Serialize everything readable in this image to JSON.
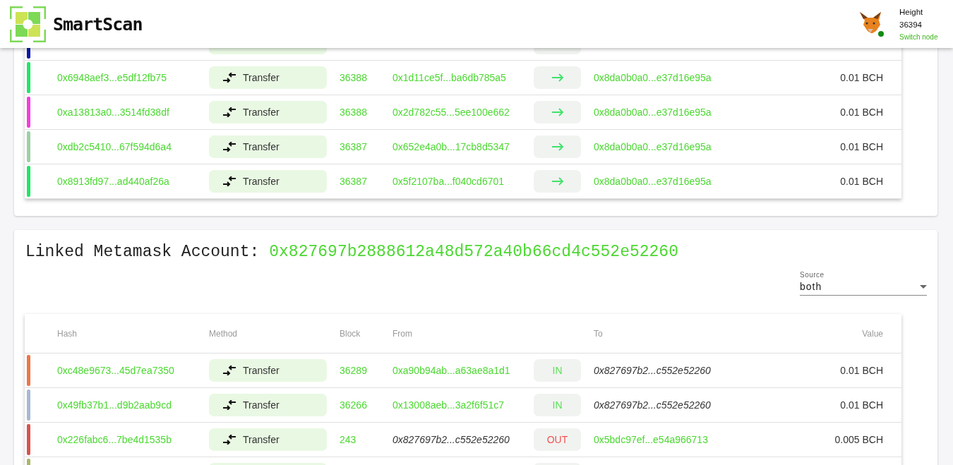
{
  "header": {
    "brand": "SmartScan",
    "height_label": "Height",
    "height_value": "36394",
    "switch_link": "Switch node",
    "node_online": true
  },
  "recent": {
    "rows": [
      {
        "kind": "partial",
        "color": "#0b1aa8"
      },
      {
        "kind": "full",
        "color": "#1de866",
        "hash": "0x6948aef3...e5df12fb75",
        "method": "Transfer",
        "block": "36388",
        "from": "0x1d11ce5f...ba6db785a5",
        "from_own": false,
        "direction": {
          "kind": "arrow"
        },
        "to": "0x8da0b0a0...e37d16e95a",
        "to_own": false,
        "value": "0.01 BCH"
      },
      {
        "kind": "full",
        "color": "#f53ddb",
        "hash": "0xa13813a0...3514fd38df",
        "method": "Transfer",
        "block": "36388",
        "from": "0x2d782c55...5ee100e662",
        "from_own": false,
        "direction": {
          "kind": "arrow"
        },
        "to": "0x8da0b0a0...e37d16e95a",
        "to_own": false,
        "value": "0.01 BCH"
      },
      {
        "kind": "full",
        "color": "#9dd1a4",
        "hash": "0xdb2c5410...67f594d6a4",
        "method": "Transfer",
        "block": "36387",
        "from": "0x652e4a0b...17cb8d5347",
        "from_own": false,
        "direction": {
          "kind": "arrow"
        },
        "to": "0x8da0b0a0...e37d16e95a",
        "to_own": false,
        "value": "0.01 BCH"
      },
      {
        "kind": "full",
        "color": "#1de866",
        "hash": "0x8913fd97...ad440af26a",
        "method": "Transfer",
        "block": "36387",
        "from": "0x5f2107ba...f040cd6701",
        "from_own": false,
        "direction": {
          "kind": "arrow"
        },
        "to": "0x8da0b0a0...e37d16e95a",
        "to_own": false,
        "value": "0.01 BCH"
      }
    ]
  },
  "account": {
    "title": "Linked Metamask Account:",
    "address": "0x827697b2888612a48d572a40b66cd4c552e52260",
    "source": {
      "label": "Source",
      "value": "both"
    },
    "columns": [
      "Hash",
      "Method",
      "Block",
      "From",
      "To",
      "Value"
    ],
    "rows": [
      {
        "kind": "full",
        "color": "#ee7547",
        "hash": "0xc48e9673...45d7ea7350",
        "method": "Transfer",
        "block": "36289",
        "from": "0xa90b94ab...a63ae8a1d1",
        "from_own": false,
        "direction": {
          "kind": "in",
          "label": "IN"
        },
        "to": "0x827697b2...c552e52260",
        "to_own": true,
        "value": "0.01 BCH"
      },
      {
        "kind": "full",
        "color": "#a7b8d4",
        "hash": "0x49fb37b1...d9b2aab9cd",
        "method": "Transfer",
        "block": "36266",
        "from": "0x13008aeb...3a2f6f51c7",
        "from_own": false,
        "direction": {
          "kind": "in",
          "label": "IN"
        },
        "to": "0x827697b2...c552e52260",
        "to_own": true,
        "value": "0.01 BCH"
      },
      {
        "kind": "full",
        "color": "#d9534f",
        "hash": "0x226fabc6...7be4d1535b",
        "method": "Transfer",
        "block": "243",
        "from": "0x827697b2...c552e52260",
        "from_own": true,
        "direction": {
          "kind": "out",
          "label": "OUT"
        },
        "to": "0x5bdc97ef...e54a966713",
        "to_own": false,
        "value": "0.005 BCH"
      },
      {
        "kind": "partial",
        "color": "#a8b86a"
      }
    ]
  }
}
